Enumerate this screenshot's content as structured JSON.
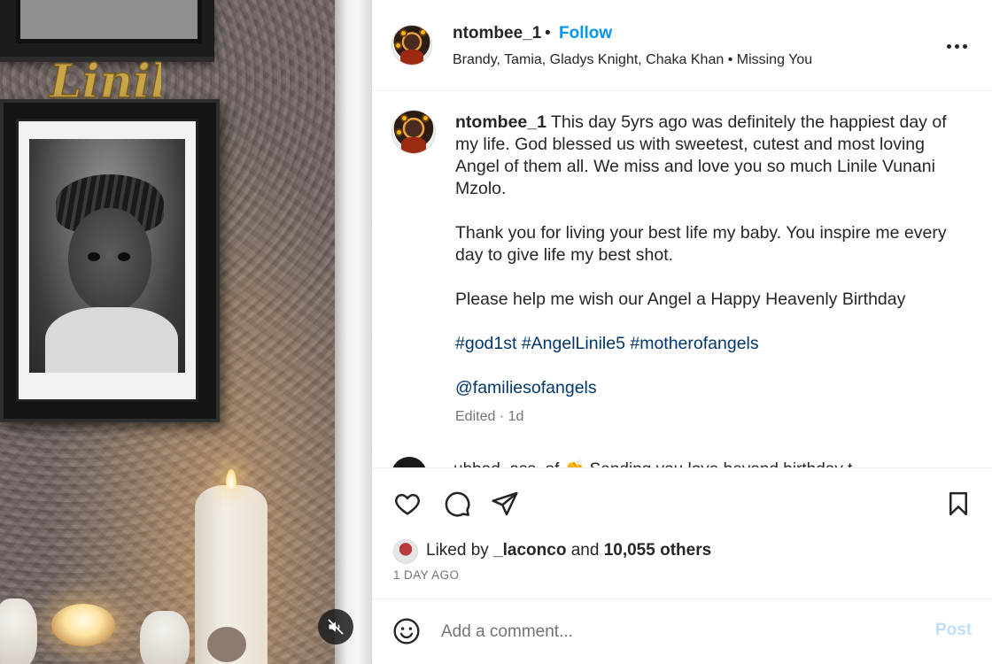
{
  "media": {
    "wall_sign_text": "Linile"
  },
  "header": {
    "username": "ntombee_1",
    "separator": "•",
    "follow_label": "Follow",
    "audio": "Brandy, Tamia, Gladys Knight, Chaka Khan • Missing You"
  },
  "caption": {
    "username": "ntombee_1",
    "paragraph1": "This day 5yrs ago was definitely the happiest day of my life. God blessed us with sweetest, cutest and most loving Angel of them all. We miss and love you so much Linile Vunani Mzolo.",
    "paragraph2": "Thank you for living your best life my baby. You inspire me every day to give life my best shot.",
    "paragraph3": "Please help me wish our Angel a Happy Heavenly Birthday",
    "hashtags": [
      "#god1st",
      "#AngelLinile5",
      "#motherofangels"
    ],
    "mention": "@familiesofangels",
    "edited": "Edited · 1d",
    "next_comment_preview": "ubbad_ass_of 👏 Sending you love beyond birthday t"
  },
  "actions": {
    "like_icon": "heart-outline-icon",
    "comment_icon": "comment-bubble-icon",
    "share_icon": "paper-plane-icon",
    "save_icon": "bookmark-icon"
  },
  "likes": {
    "prefix": "Liked by",
    "user": "_laconco",
    "conjunction": "and",
    "others": "10,055 others"
  },
  "post_age": "1 DAY AGO",
  "comment_bar": {
    "emoji_icon": "smiley-icon",
    "placeholder": "Add a comment...",
    "post_label": "Post"
  },
  "colors": {
    "link_blue": "#0095f6",
    "hashtag_navy": "#00376b",
    "muted_gray": "#737373",
    "post_disabled": "#c0dffd"
  }
}
